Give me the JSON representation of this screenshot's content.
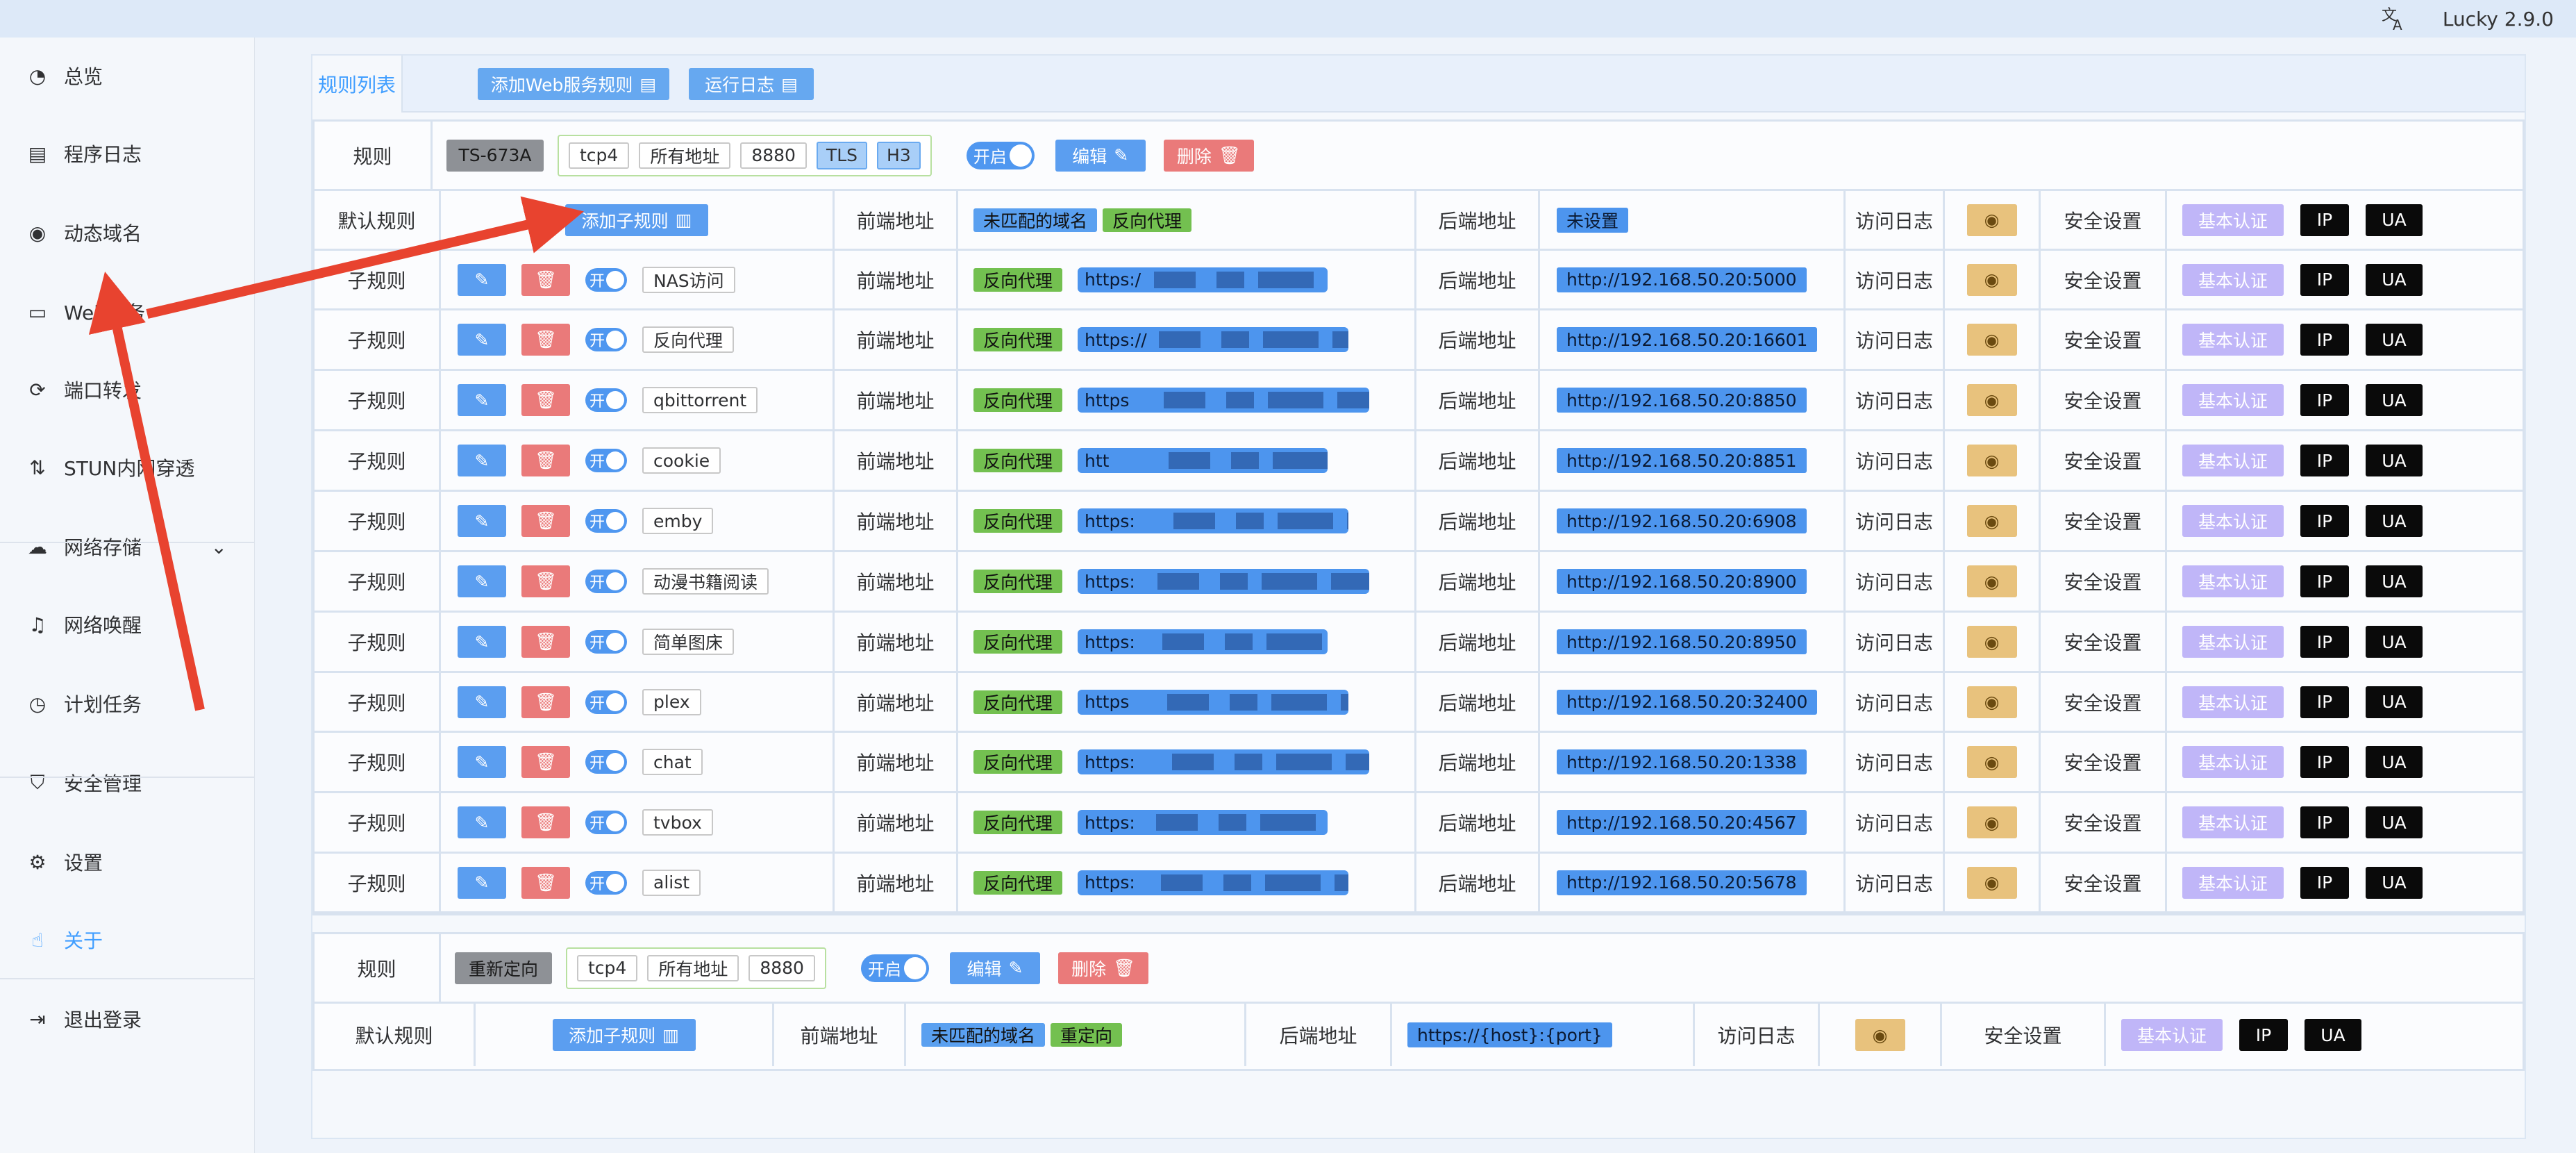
{
  "app": {
    "title": "Lucky 2.9.0",
    "translate_icon": "translate-icon"
  },
  "sidebar": {
    "items": [
      {
        "label": "总览",
        "icon": "dashboard-icon"
      },
      {
        "label": "程序日志",
        "icon": "log-icon"
      },
      {
        "label": "动态域名",
        "icon": "dns-icon"
      },
      {
        "label": "Web服务",
        "icon": "web-icon"
      },
      {
        "label": "端口转发",
        "icon": "port-forward-icon"
      },
      {
        "label": "STUN内网穿透",
        "icon": "stun-icon"
      },
      {
        "label": "网络存储",
        "icon": "cloud-icon"
      },
      {
        "label": "网络唤醒",
        "icon": "bell-icon"
      },
      {
        "label": "计划任务",
        "icon": "clock-icon"
      },
      {
        "label": "安全管理",
        "icon": "shield-icon"
      },
      {
        "label": "设置",
        "icon": "gear-icon"
      },
      {
        "label": "关于",
        "icon": "about-icon"
      },
      {
        "label": "退出登录",
        "icon": "logout-icon"
      }
    ]
  },
  "tabs": {
    "rule_list": "规则列表",
    "add_web_rule": "添加Web服务规则",
    "run_log": "运行日志"
  },
  "labels": {
    "rule": "规则",
    "default_rule": "默认规则",
    "sub_rule": "子规则",
    "add_sub_rule": "添加子规则",
    "frontend": "前端地址",
    "backend": "后端地址",
    "access_log": "访问日志",
    "security": "安全设置",
    "basic_auth": "基本认证",
    "ip": "IP",
    "ua": "UA",
    "on": "开启",
    "on_short": "开",
    "edit": "编辑",
    "delete": "删除",
    "unmatched_domain": "未匹配的域名"
  },
  "rule1": {
    "name": "TS-673A",
    "protocol": "tcp4",
    "addr": "所有地址",
    "port": "8880",
    "tls": "TLS",
    "h3": "H3",
    "default_type": "反向代理",
    "default_backend": "未设置",
    "subrules": [
      {
        "name": "NAS访问",
        "type": "反向代理",
        "frontend": "https:/",
        "backend": "http://192.168.50.20:5000"
      },
      {
        "name": "反向代理",
        "type": "反向代理",
        "frontend": "https://",
        "backend": "http://192.168.50.20:16601"
      },
      {
        "name": "qbittorrent",
        "type": "反向代理",
        "frontend": "https",
        "backend": "http://192.168.50.20:8850"
      },
      {
        "name": "cookie",
        "type": "反向代理",
        "frontend": "htt",
        "backend": "http://192.168.50.20:8851"
      },
      {
        "name": "emby",
        "type": "反向代理",
        "frontend": "https:",
        "backend": "http://192.168.50.20:6908"
      },
      {
        "name": "动漫书籍阅读",
        "type": "反向代理",
        "frontend": "https:",
        "backend": "http://192.168.50.20:8900"
      },
      {
        "name": "简单图床",
        "type": "反向代理",
        "frontend": "https:",
        "backend": "http://192.168.50.20:8950"
      },
      {
        "name": "plex",
        "type": "反向代理",
        "frontend": "https",
        "backend": "http://192.168.50.20:32400"
      },
      {
        "name": "chat",
        "type": "反向代理",
        "frontend": "https:",
        "backend": "http://192.168.50.20:1338"
      },
      {
        "name": "tvbox",
        "type": "反向代理",
        "frontend": "https:",
        "backend": "http://192.168.50.20:4567"
      },
      {
        "name": "alist",
        "type": "反向代理",
        "frontend": "https:",
        "backend": "http://192.168.50.20:5678"
      }
    ]
  },
  "rule2": {
    "name": "重新定向",
    "protocol": "tcp4",
    "addr": "所有地址",
    "port": "8880",
    "default_type": "重定向",
    "default_backend": "https://{host}:{port}"
  },
  "colors": {
    "accent": "#409eff",
    "green_tag": "#73c050",
    "blue_tag": "#5aa0f0",
    "arrow": "#e8432f"
  }
}
